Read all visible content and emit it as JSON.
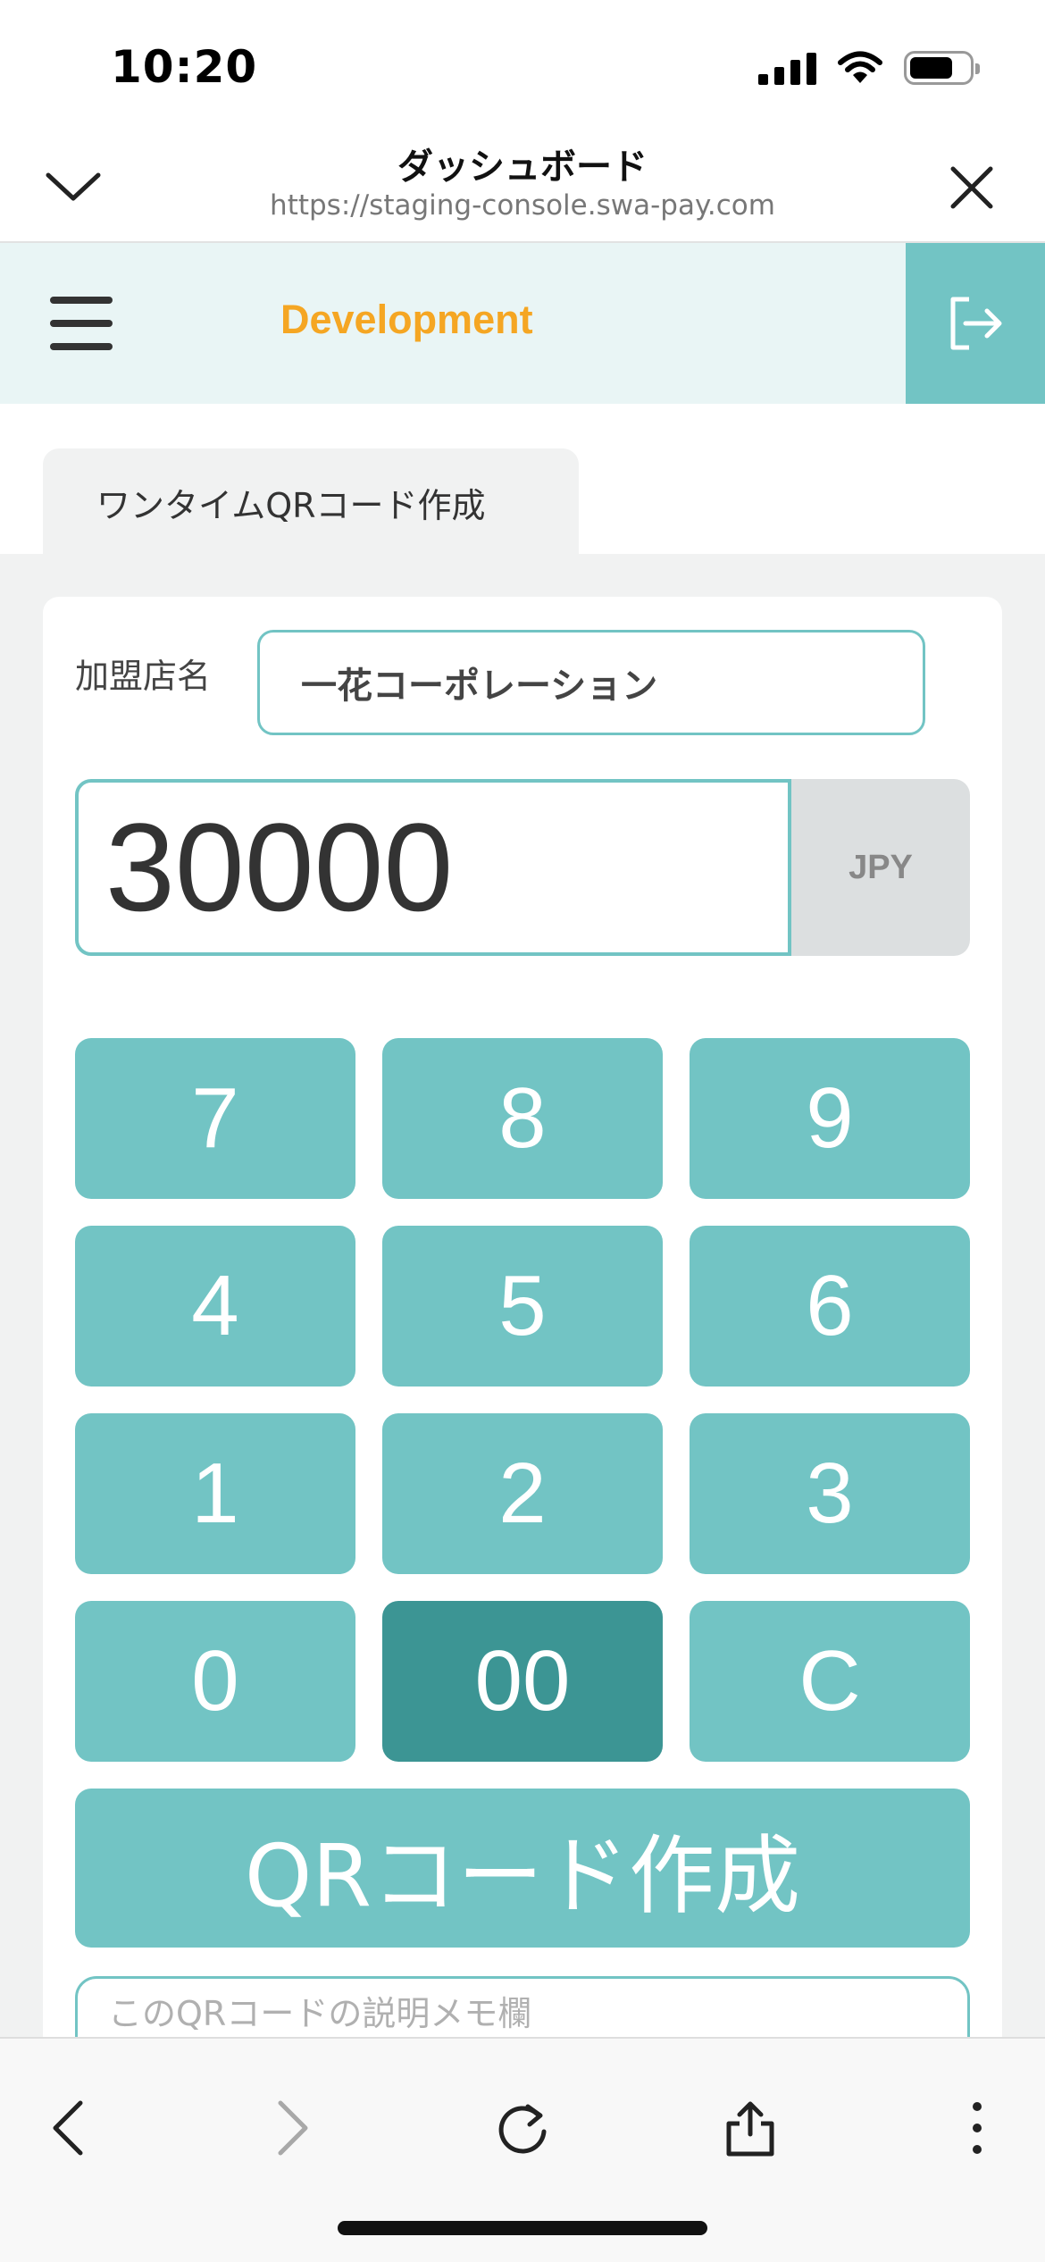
{
  "status_bar": {
    "time": "10:20"
  },
  "browser": {
    "title": "ダッシュボード",
    "url": "https://staging-console.swa-pay.com"
  },
  "app_bar": {
    "environment": "Development"
  },
  "tab": {
    "label": "ワンタイムQRコード作成"
  },
  "form": {
    "merchant_label": "加盟店名",
    "merchant_value": "一花コーポレーション",
    "amount_value": "30000",
    "currency": "JPY",
    "memo_placeholder": "このQRコードの説明メモ欄"
  },
  "keypad": {
    "keys": [
      "7",
      "8",
      "9",
      "4",
      "5",
      "6",
      "1",
      "2",
      "3",
      "0",
      "00",
      "C"
    ],
    "pressed_key": "00"
  },
  "actions": {
    "create_qr_label": "QRコード作成"
  },
  "colors": {
    "accent": "#72c4c4",
    "accent_pressed": "#3c9594",
    "environment": "#f5a623",
    "app_bar_bg": "#e9f5f5"
  },
  "icons": {
    "header_left": "chevron-down-icon",
    "header_right": "close-icon",
    "menu": "hamburger-icon",
    "logout": "logout-icon",
    "toolbar": [
      "back-icon",
      "forward-icon",
      "reload-icon",
      "share-icon",
      "more-icon"
    ]
  }
}
